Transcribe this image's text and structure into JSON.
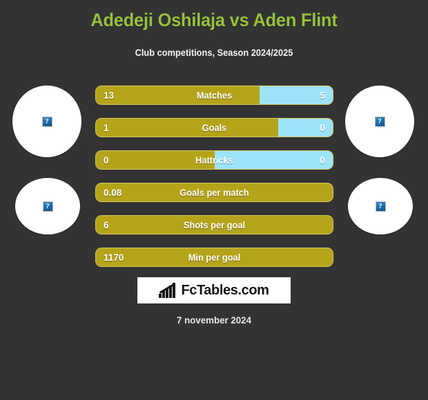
{
  "header": {
    "title": "Adedeji Oshilaja vs Aden Flint",
    "subtitle": "Club competitions, Season 2024/2025"
  },
  "colors": {
    "background": "#333333",
    "title": "#96c13d",
    "bar_left": "#b5a419",
    "bar_right": "#9ce3fa",
    "bar_border": "#d7c95f",
    "text": "#ffffff"
  },
  "avatars": [
    {
      "name": "player-left-photo-1",
      "placeholder": "?"
    },
    {
      "name": "player-left-photo-2",
      "placeholder": "?"
    },
    {
      "name": "player-right-photo-1",
      "placeholder": "?"
    },
    {
      "name": "player-right-photo-2",
      "placeholder": "?"
    }
  ],
  "chart_data": {
    "type": "bar",
    "title": "Adedeji Oshilaja vs Aden Flint",
    "subtitle": "Club competitions, Season 2024/2025",
    "orientation": "horizontal-diverging",
    "series": [
      {
        "name": "Adedeji Oshilaja",
        "color": "#b5a419",
        "side": "left"
      },
      {
        "name": "Aden Flint",
        "color": "#9ce3fa",
        "side": "right"
      }
    ],
    "categories": [
      "Matches",
      "Goals",
      "Hattricks",
      "Goals per match",
      "Shots per goal",
      "Min per goal"
    ],
    "rows": [
      {
        "label": "Matches",
        "left_value": "13",
        "right_value": "5",
        "left_pct": 69,
        "right_pct": 31,
        "split": true
      },
      {
        "label": "Goals",
        "left_value": "1",
        "right_value": "0",
        "left_pct": 77,
        "right_pct": 23,
        "split": true
      },
      {
        "label": "Hattricks",
        "left_value": "0",
        "right_value": "0",
        "left_pct": 50,
        "right_pct": 50,
        "split": true
      },
      {
        "label": "Goals per match",
        "left_value": "0.08",
        "right_value": "",
        "left_pct": 100,
        "right_pct": 0,
        "split": false
      },
      {
        "label": "Shots per goal",
        "left_value": "6",
        "right_value": "",
        "left_pct": 100,
        "right_pct": 0,
        "split": false
      },
      {
        "label": "Min per goal",
        "left_value": "1170",
        "right_value": "",
        "left_pct": 100,
        "right_pct": 0,
        "split": false
      }
    ]
  },
  "logo": {
    "text": "FcTables.com",
    "icon": "bar-chart-icon"
  },
  "footer": {
    "date": "7 november 2024"
  }
}
